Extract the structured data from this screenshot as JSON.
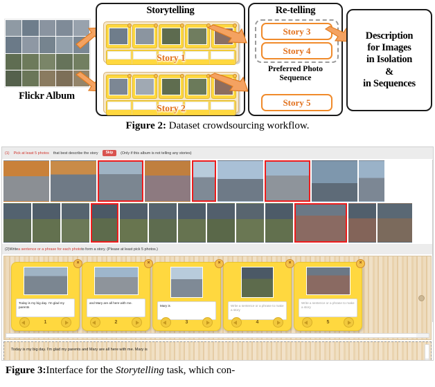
{
  "figure2": {
    "caption_label": "Figure 2:",
    "caption_text": "Dataset crowdsourcing workflow.",
    "album": {
      "label": "Flickr Album",
      "rows": 4,
      "cols": 5
    },
    "storytelling": {
      "title": "Storytelling",
      "stories": [
        {
          "label": "Story 1",
          "cards": 5
        },
        {
          "label": "Story 2",
          "cards": 5
        }
      ]
    },
    "retelling": {
      "title": "Re-telling",
      "preferred_label_line1": "Preferred Photo",
      "preferred_label_line2": "Sequence",
      "grouped_stories": [
        "Story 3",
        "Story 4"
      ],
      "separate_story": "Story 5"
    },
    "description": {
      "lines": [
        "Description",
        "for Images",
        "in Isolation",
        "&",
        "in Sequences"
      ]
    },
    "colors": {
      "arrow": "#F4A261",
      "arrow_border": "#E07B20",
      "story_text": "#E2711D",
      "card_yellow": "#FFD83F",
      "panel_border": "#1A1A1A",
      "dashed_group": "#9A9A9A"
    }
  },
  "figure3": {
    "caption_label": "Figure 3:",
    "caption_text_1": "Interface for the ",
    "caption_italic": "Storytelling",
    "caption_text_2": " task, which con-",
    "instruction1": {
      "number": "(1)",
      "highlight": "Pick at least 5 photos",
      "rest": "that best describe the story",
      "skip_label": "Skip",
      "note": "(Only if this album is not telling any stories)"
    },
    "instruction2": {
      "number": "(2)",
      "text_before": "Write ",
      "highlight": "a sentence or a phrase for each photo",
      "text_after": " to form a story. (Please at least pick 5 photos.)"
    },
    "photo_rows": [
      {
        "count": 9,
        "widths": [
          66,
          66,
          66,
          66,
          35,
          66,
          66,
          66,
          37
        ],
        "selected": [
          2,
          4,
          6
        ]
      },
      {
        "count": 13,
        "widths": [
          40,
          40,
          40,
          40,
          40,
          40,
          40,
          40,
          40,
          40,
          76,
          40,
          50
        ],
        "selected": [
          3,
          10
        ]
      }
    ],
    "cards": [
      {
        "number": "1",
        "text": "Today is my big day. I'm glad my parents",
        "is_placeholder": false,
        "photo": "landscape"
      },
      {
        "number": "2",
        "text": "and Mary are all here with me.",
        "is_placeholder": false,
        "photo": "landscape"
      },
      {
        "number": "3",
        "text": "Mary is",
        "is_placeholder": false,
        "photo": "portrait"
      },
      {
        "number": "4",
        "text": "Write a sentence or a phrase to make a story",
        "is_placeholder": true,
        "photo": "portrait"
      },
      {
        "number": "5",
        "text": "Write a sentence or a phrase to make a story",
        "is_placeholder": true,
        "photo": "landscape"
      }
    ],
    "card_nav": {
      "prev_icon": "left-arrow-icon",
      "next_icon": "right-arrow-icon",
      "remove_icon": "close-icon"
    },
    "story_textarea": {
      "value": "Today is my big day. I'm glad my parents and Mary are all here with me. Mary is"
    },
    "colors": {
      "skip_button": "#D9534F",
      "instruction_highlight": "#D0342C",
      "selection_border": "#EE1C1C",
      "card_yellow": "#FFD83F",
      "board_wood": "#EEDCBE"
    }
  }
}
